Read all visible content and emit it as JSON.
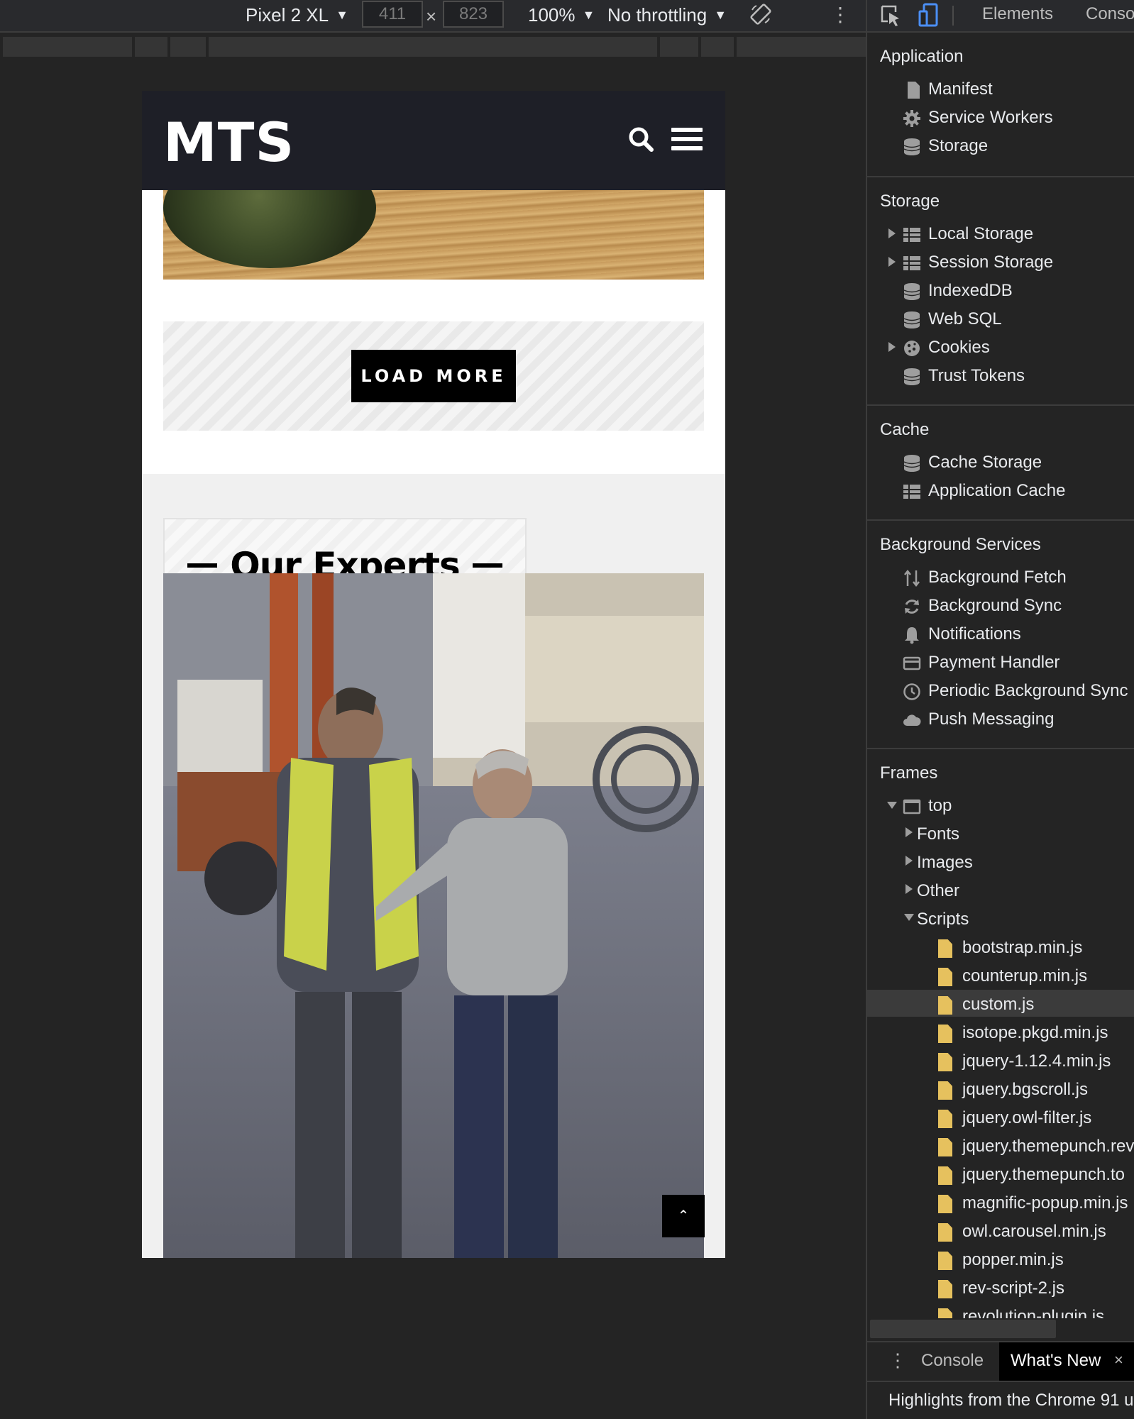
{
  "device_toolbar": {
    "device": "Pixel 2 XL",
    "width": "411",
    "height": "823",
    "zoom": "100%",
    "throttling": "No throttling"
  },
  "site": {
    "logo": "MTS",
    "load_more": "LOAD MORE",
    "section_title": "Our Experts",
    "back_to_top": "⌃"
  },
  "devtools": {
    "tabs": [
      "Elements",
      "Conso"
    ],
    "sections": {
      "application": {
        "title": "Application",
        "items": [
          "Manifest",
          "Service Workers",
          "Storage"
        ]
      },
      "storage": {
        "title": "Storage",
        "items": [
          "Local Storage",
          "Session Storage",
          "IndexedDB",
          "Web SQL",
          "Cookies",
          "Trust Tokens"
        ]
      },
      "cache": {
        "title": "Cache",
        "items": [
          "Cache Storage",
          "Application Cache"
        ]
      },
      "background_services": {
        "title": "Background Services",
        "items": [
          "Background Fetch",
          "Background Sync",
          "Notifications",
          "Payment Handler",
          "Periodic Background Sync",
          "Push Messaging"
        ]
      },
      "frames": {
        "title": "Frames",
        "top": "top",
        "folders": [
          "Fonts",
          "Images",
          "Other",
          "Scripts"
        ],
        "scripts": [
          "bootstrap.min.js",
          "counterup.min.js",
          "custom.js",
          "isotope.pkgd.min.js",
          "jquery-1.12.4.min.js",
          "jquery.bgscroll.js",
          "jquery.owl-filter.js",
          "jquery.themepunch.rev",
          "jquery.themepunch.to",
          "magnific-popup.min.js",
          "owl.carousel.min.js",
          "popper.min.js",
          "rev-script-2.js",
          "revolution-plugin.js"
        ],
        "selected_script": "custom.js"
      }
    },
    "drawer": {
      "console": "Console",
      "whats_new": "What's New",
      "close": "×",
      "highlight": "Highlights from the Chrome 91 u"
    }
  },
  "colors": {
    "header_bg": "#1e1f27",
    "file_icon": "#e6c15e",
    "devtools_bg": "#242424"
  }
}
